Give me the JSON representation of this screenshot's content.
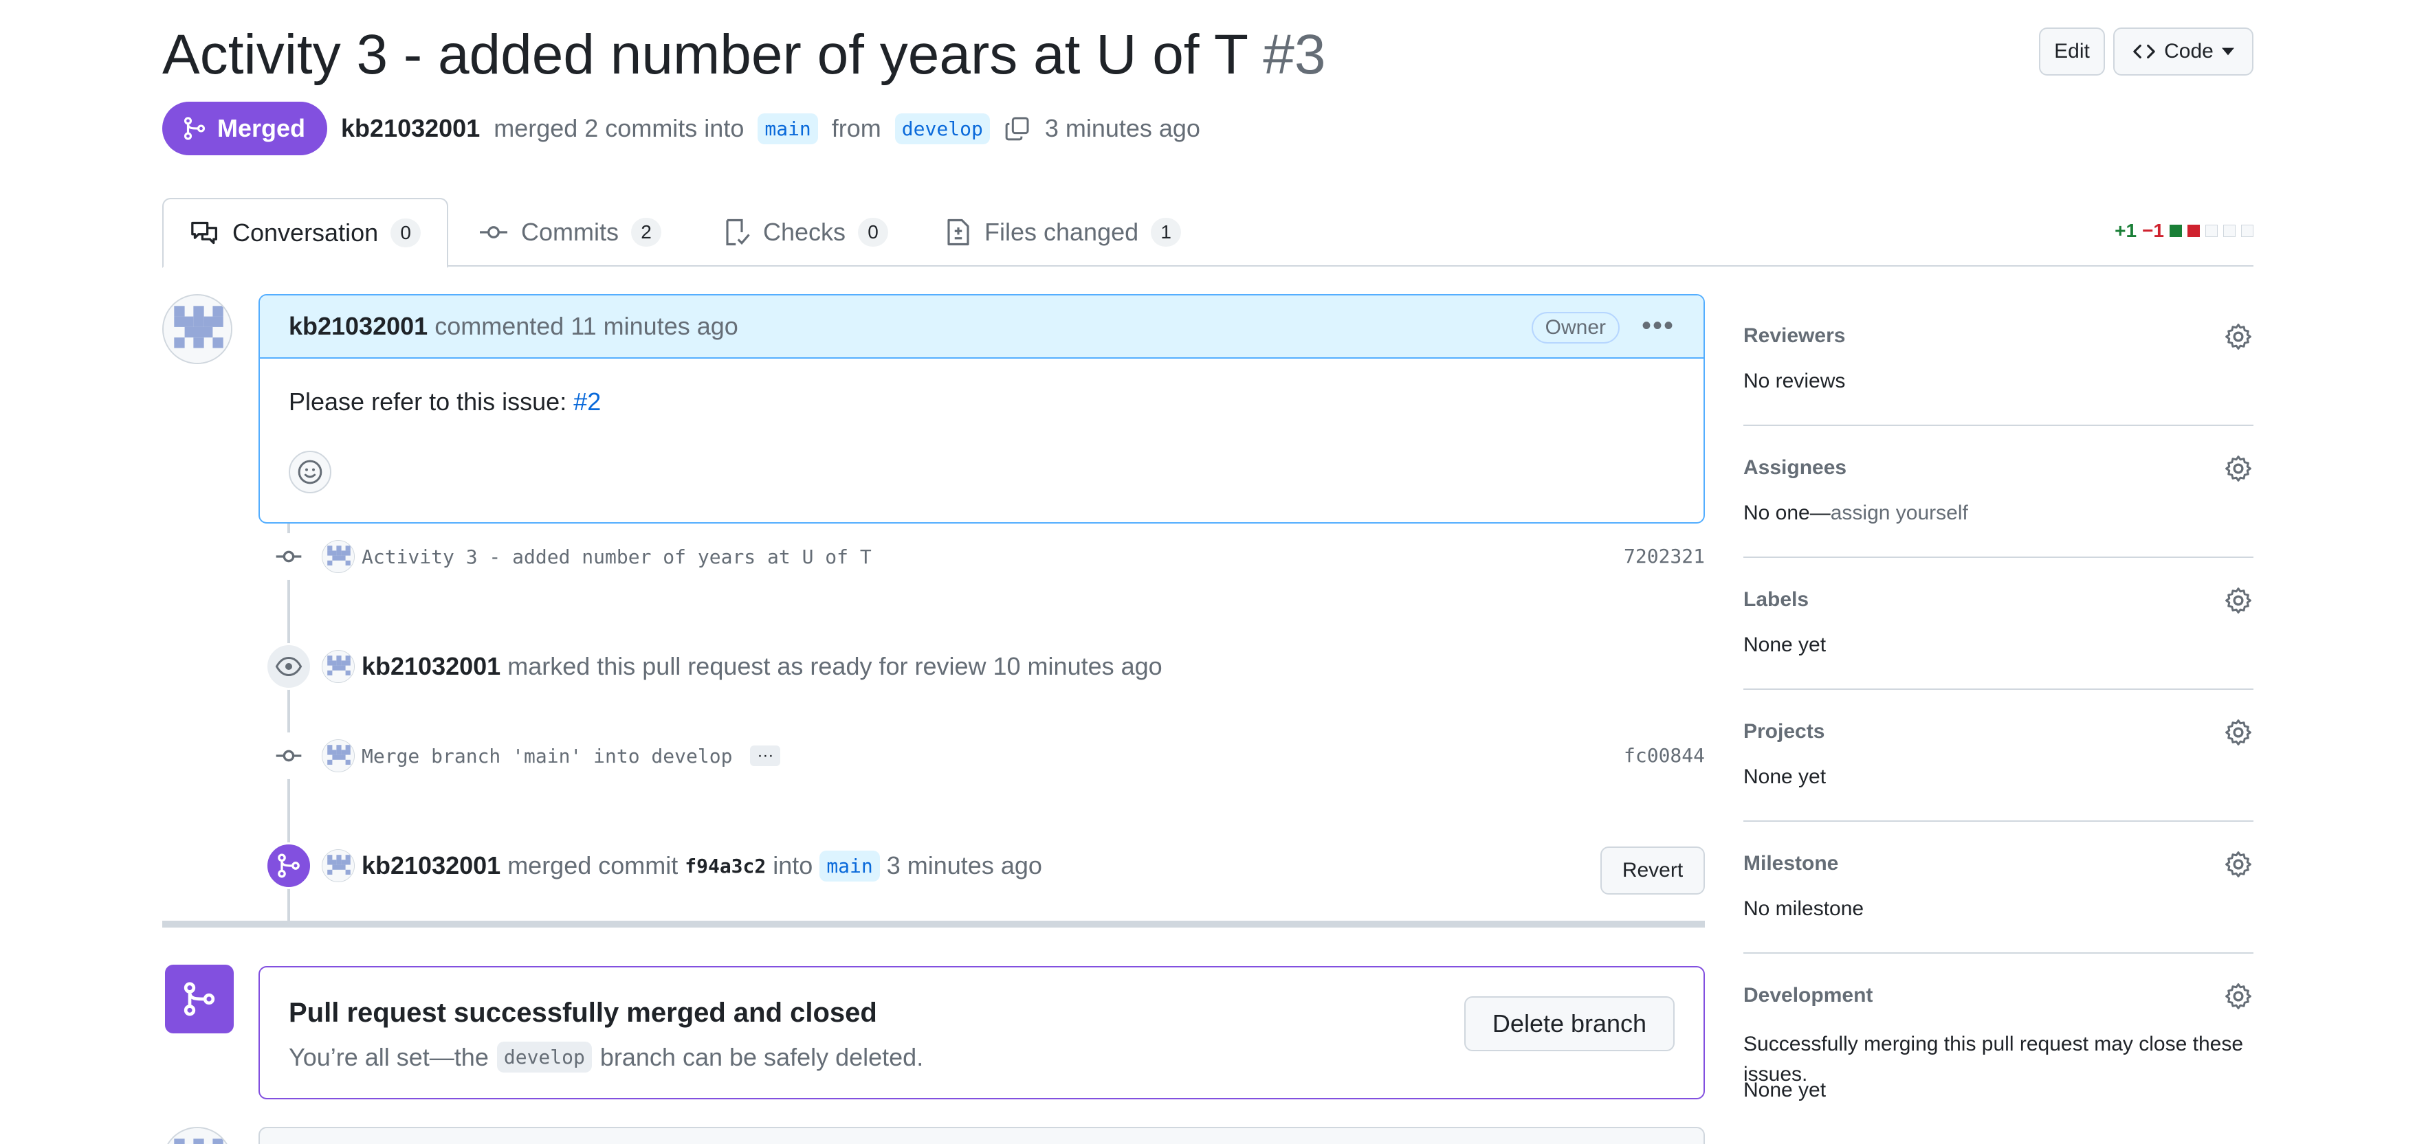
{
  "header": {
    "title": "Activity 3 - added number of years at U of T",
    "number": "#3",
    "edit_label": "Edit",
    "code_label": "Code"
  },
  "meta": {
    "status": "Merged",
    "author": "kb21032001",
    "action": "merged 2 commits into",
    "base_branch": "main",
    "from_text": "from",
    "head_branch": "develop",
    "time": "3 minutes ago"
  },
  "tabs": [
    {
      "label": "Conversation",
      "count": "0"
    },
    {
      "label": "Commits",
      "count": "2"
    },
    {
      "label": "Checks",
      "count": "0"
    },
    {
      "label": "Files changed",
      "count": "1"
    }
  ],
  "diffstat": {
    "additions": "+1",
    "deletions": "−1"
  },
  "comment": {
    "author": "kb21032001",
    "action": "commented 11 minutes ago",
    "badge": "Owner",
    "body_text": "Please refer to this issue:",
    "body_link": "#2"
  },
  "timeline": {
    "commit1": {
      "message": "Activity 3 - added number of years at U of T",
      "sha": "7202321"
    },
    "ready": {
      "user": "kb21032001",
      "text": "marked this pull request as ready for review 10 minutes ago"
    },
    "commit2": {
      "message": "Merge branch 'main' into develop",
      "dots": "···",
      "sha": "fc00844"
    },
    "merge": {
      "user": "kb21032001",
      "text1": "merged commit",
      "sha": "f94a3c2",
      "text2": "into",
      "branch": "main",
      "time": "3 minutes ago",
      "revert_label": "Revert"
    }
  },
  "merged_box": {
    "title": "Pull request successfully merged and closed",
    "sub_before": "You’re all set—the",
    "branch": "develop",
    "sub_after": "branch can be safely deleted.",
    "delete_label": "Delete branch"
  },
  "sidebar": {
    "reviewers": {
      "label": "Reviewers",
      "value": "No reviews"
    },
    "assignees": {
      "label": "Assignees",
      "value": "No one—",
      "link": "assign yourself"
    },
    "labels": {
      "label": "Labels",
      "value": "None yet"
    },
    "projects": {
      "label": "Projects",
      "value": "None yet"
    },
    "milestone": {
      "label": "Milestone",
      "value": "No milestone"
    },
    "development": {
      "label": "Development",
      "description": "Successfully merging this pull request may close these issues.",
      "value": "None yet"
    }
  },
  "colors": {
    "accent_purple": "#8250df",
    "link_blue": "#0969da",
    "comment_header": "#ddf4ff",
    "add_green": "#1a7f37",
    "del_red": "#cf222e"
  }
}
